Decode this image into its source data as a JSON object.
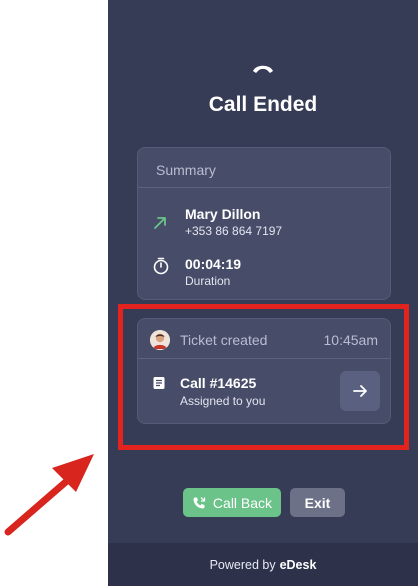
{
  "header": {
    "title": "Call Ended",
    "icon": "phone-hangup-icon"
  },
  "summary": {
    "heading": "Summary",
    "caller": {
      "name": "Mary Dillon",
      "phone": "+353 86 864 7197",
      "icon": "outgoing-call-arrow-icon"
    },
    "duration": {
      "value": "00:04:19",
      "label": "Duration",
      "icon": "stopwatch-icon"
    }
  },
  "ticket": {
    "label": "Ticket created",
    "time": "10:45am",
    "title": "Call #14625",
    "subtitle": "Assigned to you",
    "icons": {
      "avatar": "agent-avatar",
      "ticket": "document-icon",
      "open": "arrow-right-icon"
    }
  },
  "actions": {
    "call_back": "Call Back",
    "exit": "Exit"
  },
  "footer": {
    "prefix": "Powered by",
    "brand": "eDesk"
  },
  "colors": {
    "panel": "#363b56",
    "card": "#474c68",
    "call_back": "#6bc38a",
    "highlight": "#e3231d"
  }
}
